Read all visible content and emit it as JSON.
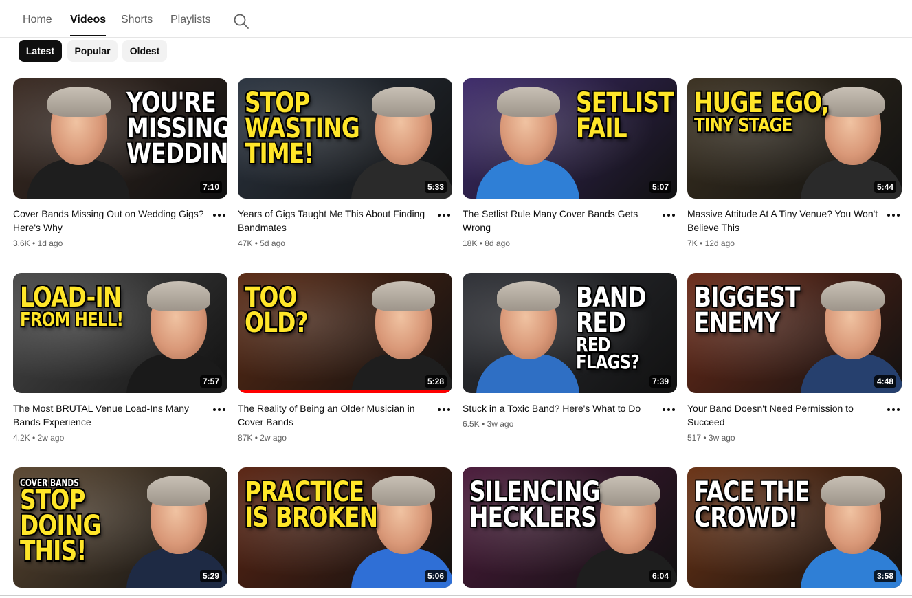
{
  "tabs": [
    {
      "label": "Home",
      "active": false
    },
    {
      "label": "Videos",
      "active": true
    },
    {
      "label": "Shorts",
      "active": false
    },
    {
      "label": "Playlists",
      "active": false
    }
  ],
  "search_icon": "search-icon",
  "chips": [
    {
      "label": "Latest",
      "active": true
    },
    {
      "label": "Popular",
      "active": false
    },
    {
      "label": "Oldest",
      "active": false
    }
  ],
  "videos": [
    {
      "title": "Cover Bands Missing Out on Wedding Gigs? Here's Why",
      "views": "3.6K",
      "age": "1d ago",
      "duration": "7:10",
      "thumb_text": [
        "YOU'RE",
        "MISSING",
        "WEDDINGS"
      ],
      "bg": "#3a2a22",
      "text_color": "#ffffff",
      "shirt": "#1e1e1e"
    },
    {
      "title": "Years of Gigs Taught Me This About Finding Bandmates",
      "views": "47K",
      "age": "5d ago",
      "duration": "5:33",
      "thumb_text": [
        "STOP",
        "WASTING",
        "TIME!"
      ],
      "bg": "#2b3440",
      "text_color": "#ffe629",
      "shirt": "#2a2a2a"
    },
    {
      "title": "The Setlist Rule Many Cover Bands Gets Wrong",
      "views": "18K",
      "age": "8d ago",
      "duration": "5:07",
      "thumb_text": [
        "SETLIST",
        "FAIL"
      ],
      "bg": "#3d2a6a",
      "text_color": "#ffe629",
      "shirt": "#2f7fd6"
    },
    {
      "title": "Massive Attitude At A Tiny Venue? You Won't Believe This",
      "views": "7K",
      "age": "12d ago",
      "duration": "5:44",
      "thumb_text": [
        "HUGE EGO,",
        "TINY STAGE"
      ],
      "bg": "#3a3020",
      "text_color": "#ffe629",
      "shirt": "#2a2a2a"
    },
    {
      "title": "The Most BRUTAL Venue Load-Ins Many Bands Experience",
      "views": "4.2K",
      "age": "2w ago",
      "duration": "7:57",
      "thumb_text": [
        "LOAD-IN",
        "FROM HELL!"
      ],
      "bg": "#4a4a4a",
      "text_color": "#ffe629",
      "shirt": "#1a1a1a"
    },
    {
      "title": "The Reality of Being an Older Musician in Cover Bands",
      "views": "87K",
      "age": "2w ago",
      "duration": "5:28",
      "thumb_text": [
        "TOO",
        "OLD?"
      ],
      "bg": "#5a2a14",
      "text_color": "#ffe629",
      "shirt": "#1e1e1e",
      "progress": 1.0
    },
    {
      "title": "Stuck in a Toxic Band? Here's What to Do",
      "views": "6.5K",
      "age": "3w ago",
      "duration": "7:39",
      "thumb_text": [
        "BAND RED",
        "RED FLAGS?"
      ],
      "bg": "#2e3036",
      "text_color": "#ffffff",
      "shirt": "#2f6fc4"
    },
    {
      "title": "Your Band Doesn't Need Permission to Succeed",
      "views": "517",
      "age": "3w ago",
      "duration": "4:48",
      "thumb_text": [
        "BIGGEST",
        "ENEMY"
      ],
      "bg": "#6a2a18",
      "text_color": "#ffffff",
      "shirt": "#26406e"
    },
    {
      "title": "",
      "views": "",
      "age": "",
      "duration": "5:29",
      "thumb_text": [
        "COVER BANDS",
        "STOP",
        "DOING",
        "THIS!"
      ],
      "bg": "#5a4630",
      "text_color": "#ffe629",
      "shirt": "#1e2a44"
    },
    {
      "title": "",
      "views": "",
      "age": "",
      "duration": "5:06",
      "thumb_text": [
        "PRACTICE",
        "IS BROKEN"
      ],
      "bg": "#5a2412",
      "text_color": "#ffe629",
      "shirt": "#2f6fd6"
    },
    {
      "title": "",
      "views": "",
      "age": "",
      "duration": "6:04",
      "thumb_text": [
        "SILENCING",
        "HECKLERS"
      ],
      "bg": "#4a1a3a",
      "text_color": "#ffffff",
      "shirt": "#1e1e1e"
    },
    {
      "title": "",
      "views": "",
      "age": "",
      "duration": "3:58",
      "thumb_text": [
        "FACE THE",
        "CROWD!"
      ],
      "bg": "#6a3214",
      "text_color": "#ffffff",
      "shirt": "#2f7fd6"
    }
  ]
}
